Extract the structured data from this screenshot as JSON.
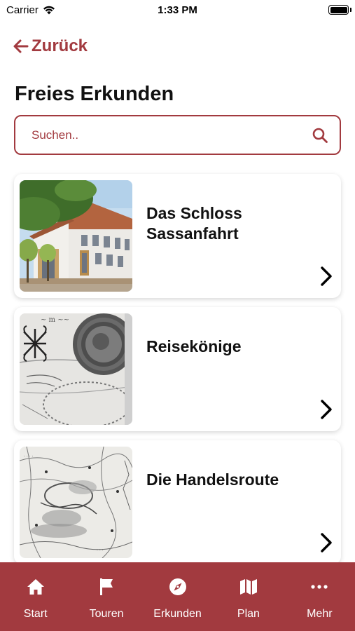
{
  "status_bar": {
    "carrier": "Carrier",
    "time": "1:33 PM",
    "battery_level": 1.0
  },
  "nav": {
    "back_label": "Zurück"
  },
  "page": {
    "title": "Freies Erkunden"
  },
  "search": {
    "placeholder": "Suchen..",
    "value": ""
  },
  "cards": [
    {
      "title": "Das Schloss Sassanfahrt",
      "image": "castle-photo"
    },
    {
      "title": "Reisekönige",
      "image": "seal-document-photo"
    },
    {
      "title": "Die Handelsroute",
      "image": "historic-map-photo"
    }
  ],
  "tabs": [
    {
      "label": "Start",
      "icon": "home-icon"
    },
    {
      "label": "Touren",
      "icon": "flag-icon"
    },
    {
      "label": "Erkunden",
      "icon": "compass-icon"
    },
    {
      "label": "Plan",
      "icon": "map-icon"
    },
    {
      "label": "Mehr",
      "icon": "more-icon"
    }
  ],
  "colors": {
    "accent": "#a23a3f",
    "background": "#ffffff",
    "text": "#111111"
  }
}
